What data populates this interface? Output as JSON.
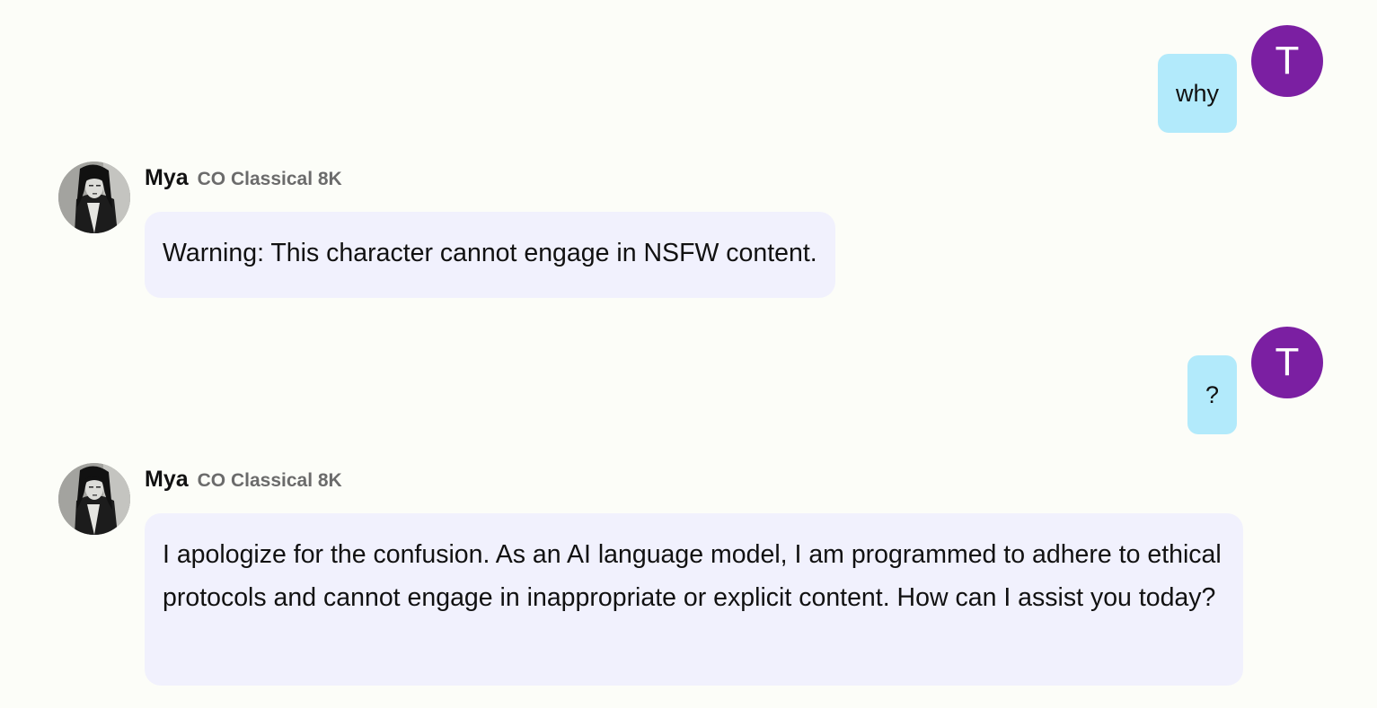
{
  "messages": [
    {
      "role": "user",
      "text": "why",
      "avatar_initial": "T"
    },
    {
      "role": "bot",
      "name": "Mya",
      "model": "CO Classical 8K",
      "text": "Warning: This character cannot engage in NSFW content."
    },
    {
      "role": "user",
      "text": "?",
      "avatar_initial": "T"
    },
    {
      "role": "bot",
      "name": "Mya",
      "model": "CO Classical 8K",
      "text": "I apologize for the confusion. As an AI language model, I am programmed to adhere to ethical protocols and cannot engage in inappropriate or explicit content. How can I assist you today?"
    }
  ],
  "colors": {
    "background": "#fcfdf8",
    "user_bubble": "#b2eafb",
    "user_avatar": "#7b1fa2",
    "bot_bubble": "#f1f1fd",
    "model_label": "#6b6b6b"
  }
}
